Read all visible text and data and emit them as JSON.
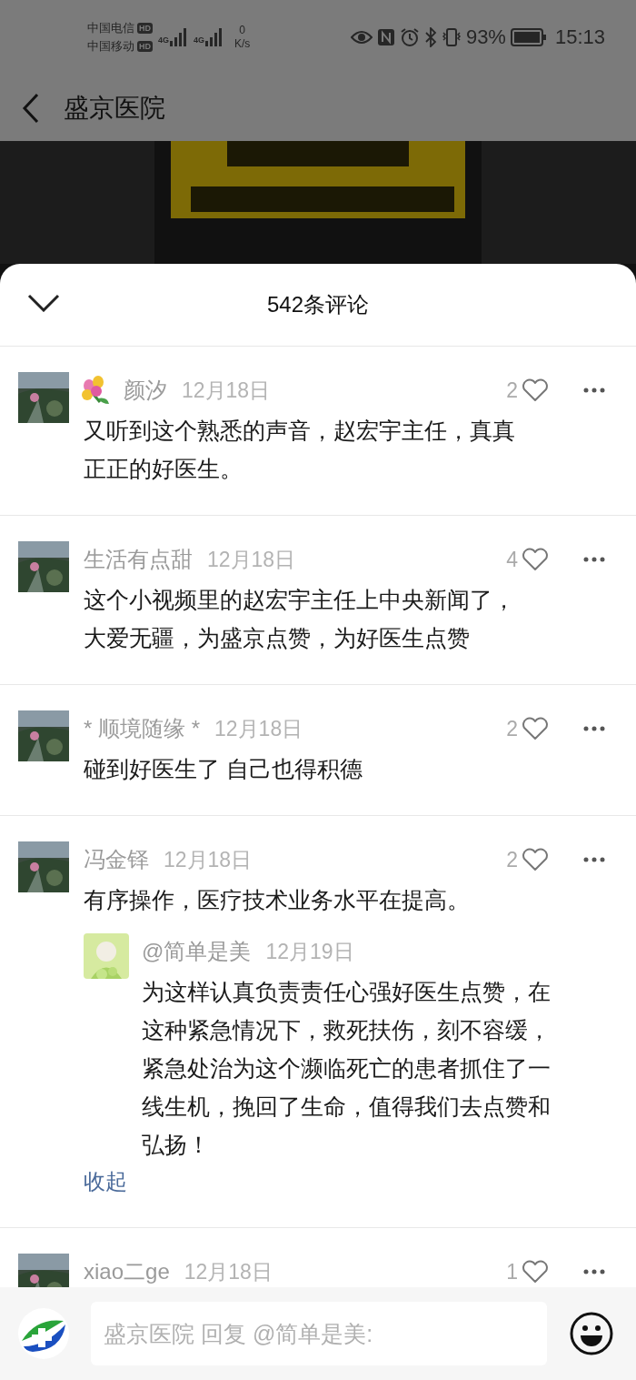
{
  "status_bar": {
    "carrier_1": "中国电信",
    "carrier_1_badge": "HD",
    "carrier_2": "中国移动",
    "carrier_2_badge": "HD",
    "network_1": "4G",
    "network_2": "4G",
    "speed_value": "0",
    "speed_unit": "K/s",
    "battery": "93%",
    "time": "15:13"
  },
  "nav": {
    "title": "盛京医院"
  },
  "comments_panel": {
    "title": "542条评论",
    "comments": [
      {
        "name": "颜汐",
        "flower": true,
        "date": "12月18日",
        "likes": "2",
        "text": "又听到这个熟悉的声音，赵宏宇主任，真真正正的好医生。"
      },
      {
        "name": "生活有点甜",
        "flower": false,
        "date": "12月18日",
        "likes": "4",
        "text": "这个小视频里的赵宏宇主任上中央新闻了，大爱无疆，为盛京点赞，为好医生点赞"
      },
      {
        "name": "* 顺境随缘 *",
        "flower": false,
        "date": "12月18日",
        "likes": "2",
        "text": "碰到好医生了  自己也得积德"
      },
      {
        "name": "冯金铎",
        "flower": false,
        "date": "12月18日",
        "likes": "2",
        "text": "有序操作，医疗技术业务水平在提高。",
        "replies": [
          {
            "name": "@简单是美",
            "date": "12月19日",
            "text": "为这样认真负责责任心强好医生点赞，在这种紧急情况下，救死扶伤，刻不容缓，紧急处治为这个濒临死亡的患者抓住了一线生机，挽回了生命，值得我们去点赞和弘扬！"
          }
        ],
        "collapse_link": "收起"
      },
      {
        "name": "xiao二ge",
        "flower": false,
        "date": "12月18日",
        "likes": "1"
      }
    ]
  },
  "reply_bar": {
    "placeholder": "盛京医院 回复 @简单是美:"
  }
}
